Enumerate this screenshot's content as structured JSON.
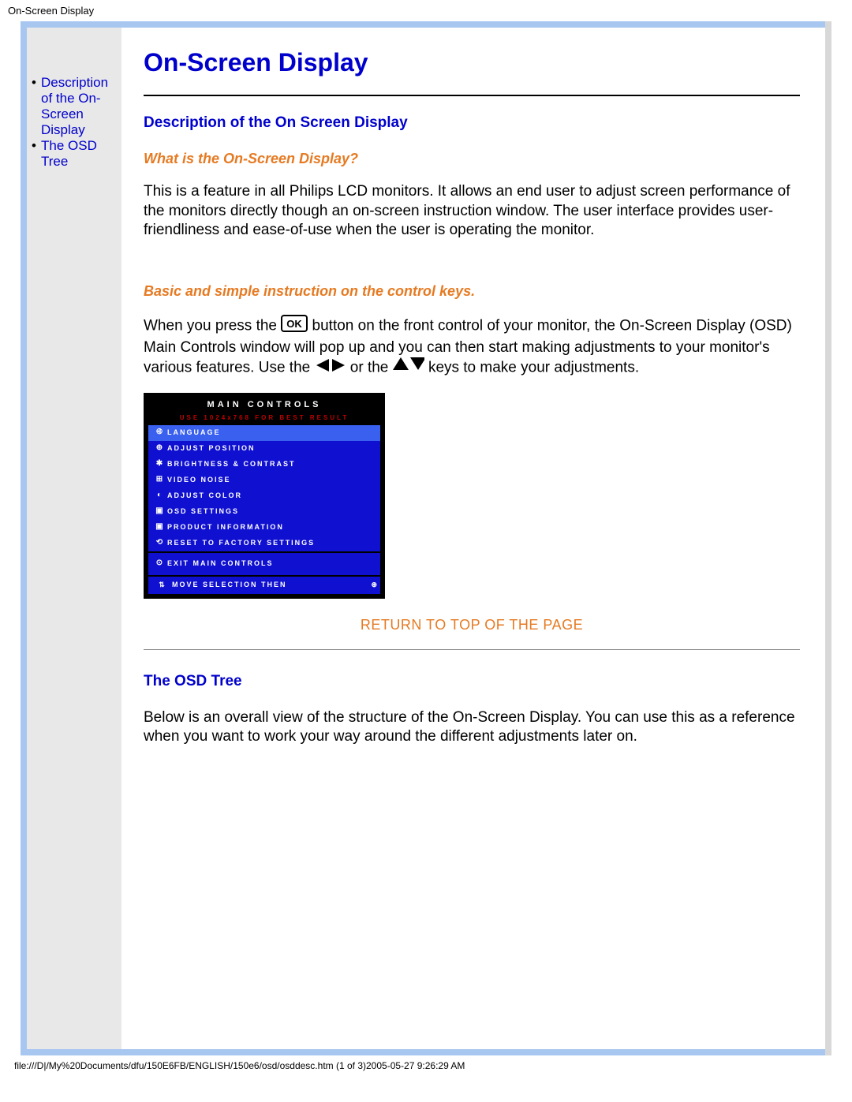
{
  "window_title": "On-Screen Display",
  "sidebar": {
    "items": [
      {
        "label": "Description of the On-Screen Display"
      },
      {
        "label": "The OSD Tree"
      }
    ]
  },
  "main": {
    "title": "On-Screen Display",
    "section1": {
      "heading": "Description of the On Screen Display",
      "sub1": "What is the On-Screen Display?",
      "para1": "This is a feature in all Philips LCD monitors. It allows an end user to adjust screen performance of the monitors directly though an on-screen instruction window. The user interface provides user-friendliness and ease-of-use when the user is operating the monitor.",
      "sub2": "Basic and simple instruction on the control keys.",
      "para2_a": "When you press the ",
      "para2_b": " button on the front control of your monitor, the On-Screen Display (OSD) Main Controls window will pop up and you can then start making adjustments to your monitor's various features. Use the ",
      "para2_c": " or the ",
      "para2_d": " keys to make your adjustments."
    },
    "osd_panel": {
      "title": "MAIN CONTROLS",
      "hint": "USE 1024x768 FOR BEST RESULT",
      "rows": [
        {
          "icon": "࿋",
          "label": "LANGUAGE",
          "hi": true
        },
        {
          "icon": "⊕",
          "label": "ADJUST POSITION"
        },
        {
          "icon": "✱",
          "label": "BRIGHTNESS & CONTRAST"
        },
        {
          "icon": "⊞",
          "label": "VIDEO NOISE"
        },
        {
          "icon": "◐",
          "label": "ADJUST COLOR"
        },
        {
          "icon": "▣",
          "label": "OSD SETTINGS"
        },
        {
          "icon": "▣",
          "label": "PRODUCT INFORMATION"
        },
        {
          "icon": "⟲",
          "label": "RESET TO FACTORY SETTINGS"
        }
      ],
      "exit": {
        "icon": "⊙",
        "label": "EXIT MAIN CONTROLS"
      },
      "footer": {
        "icon": "⇅",
        "label": "MOVE SELECTION THEN",
        "end_icon": "⊛"
      }
    },
    "return_link": "RETURN TO TOP OF THE PAGE",
    "section2": {
      "heading": "The OSD Tree",
      "para": "Below is an overall view of the structure of the On-Screen Display. You can use this as a reference when you want to work your way around the different adjustments later on."
    }
  },
  "footer_path": "file:///D|/My%20Documents/dfu/150E6FB/ENGLISH/150e6/osd/osddesc.htm (1 of 3)2005-05-27 9:26:29 AM"
}
